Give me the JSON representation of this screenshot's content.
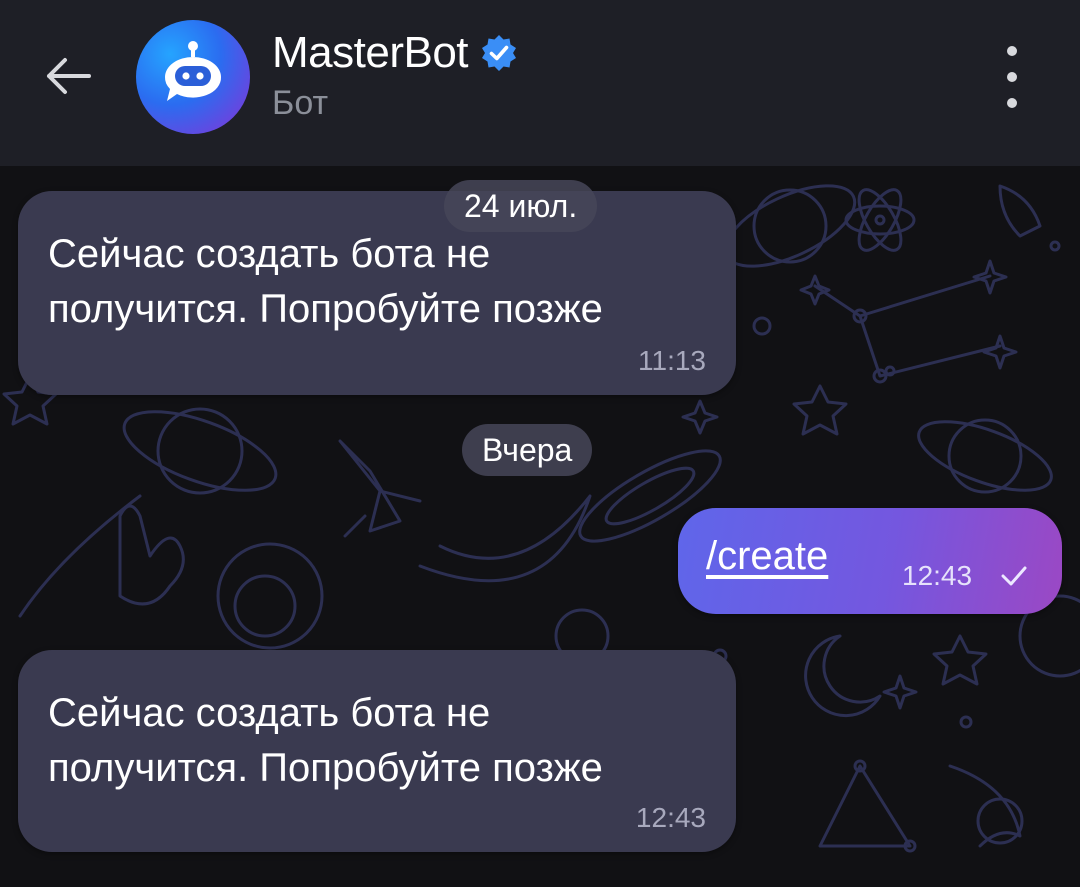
{
  "header": {
    "title": "MasterBot",
    "subtitle": "Бот",
    "icons": {
      "back": "arrow-left-icon",
      "verified": "verified-badge-icon",
      "more": "more-vertical-icon",
      "avatar": "robot-chat-icon"
    },
    "colors": {
      "header_bg": "#1e1f26",
      "verified": "#3a8ef6"
    }
  },
  "messages": [
    {
      "type": "date",
      "text": "24 июл."
    },
    {
      "type": "incoming",
      "text_line1": "Сейчас создать бота не",
      "text_line2": "получится. Попробуйте позже",
      "time": "11:13"
    },
    {
      "type": "date",
      "text": "Вчера"
    },
    {
      "type": "outgoing",
      "text": "/create",
      "time": "12:43",
      "status": "sent-check-icon"
    },
    {
      "type": "incoming",
      "text_line1": "Сейчас создать бота не",
      "text_line2": "получится. Попробуйте позже",
      "time": "12:43"
    }
  ],
  "colors": {
    "chat_bg": "#111114",
    "incoming_bubble": "#3a3a50",
    "outgoing_gradient_start": "#5f66ea",
    "outgoing_gradient_end": "#9b48c4",
    "doodle": "#2c2f52"
  }
}
